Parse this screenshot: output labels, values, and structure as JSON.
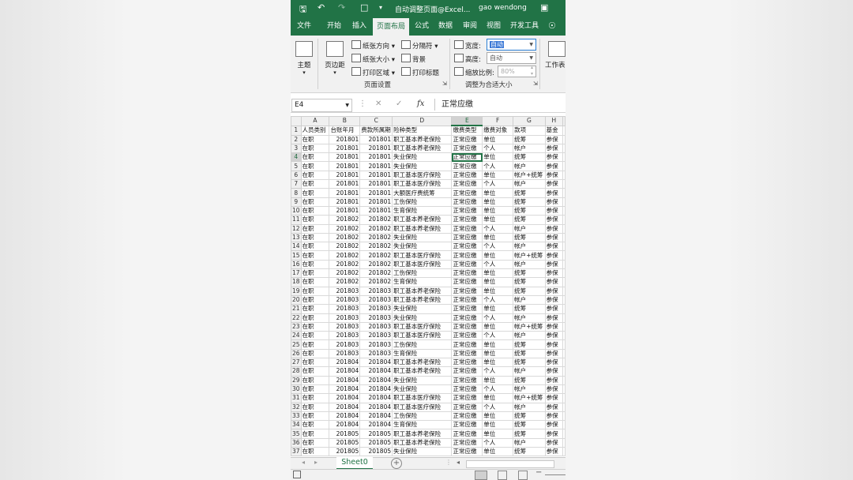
{
  "title_bar": {
    "save_icon": "save-icon",
    "undo_icon": "undo-icon",
    "redo_icon": "redo-icon",
    "new_icon": "new-file-icon",
    "title": "自动调整页面@Excel...",
    "user": "gao wendong"
  },
  "tabs": [
    "文件",
    "开始",
    "插入",
    "页面布局",
    "公式",
    "数据",
    "审阅",
    "视图",
    "开发工具"
  ],
  "active_tab": "页面布局",
  "ribbon": {
    "theme_label": "主题",
    "margins_label": "页边距",
    "orientation_label": "纸张方向",
    "size_label": "纸张大小",
    "print_area_label": "打印区域",
    "breaks_label": "分隔符",
    "background_label": "背景",
    "print_titles_label": "打印标题",
    "page_setup_group": "页面设置",
    "width_label": "宽度:",
    "width_value": "自动",
    "height_label": "高度:",
    "height_value": "自动",
    "scale_label": "缩放比例:",
    "scale_value": "80%",
    "scale_group": "调整为合适大小",
    "sheet_options_label": "工作表"
  },
  "formula_bar": {
    "name_box": "E4",
    "cancel_icon": "✕",
    "enter_icon": "✓",
    "fx_icon": "fx",
    "content": "正常应缴"
  },
  "columns": [
    "A",
    "B",
    "C",
    "D",
    "E",
    "F",
    "G",
    "H"
  ],
  "header_row": [
    "人员类别",
    "台账年月",
    "费款所属期",
    "险种类型",
    "缴费类型",
    "缴费对象",
    "款项",
    "基金"
  ],
  "rows": [
    [
      "在职",
      "201801",
      "201801",
      "职工基本养老保险",
      "正常应缴",
      "单位",
      "统筹",
      "参保"
    ],
    [
      "在职",
      "201801",
      "201801",
      "职工基本养老保险",
      "正常应缴",
      "个人",
      "帐户",
      "参保"
    ],
    [
      "在职",
      "201801",
      "201801",
      "失业保险",
      "正常应缴",
      "单位",
      "统筹",
      "参保"
    ],
    [
      "在职",
      "201801",
      "201801",
      "失业保险",
      "正常应缴",
      "个人",
      "帐户",
      "参保"
    ],
    [
      "在职",
      "201801",
      "201801",
      "职工基本医疗保险",
      "正常应缴",
      "单位",
      "帐户+统筹",
      "参保"
    ],
    [
      "在职",
      "201801",
      "201801",
      "职工基本医疗保险",
      "正常应缴",
      "个人",
      "帐户",
      "参保"
    ],
    [
      "在职",
      "201801",
      "201801",
      "大额医疗费统筹",
      "正常应缴",
      "单位",
      "统筹",
      "参保"
    ],
    [
      "在职",
      "201801",
      "201801",
      "工伤保险",
      "正常应缴",
      "单位",
      "统筹",
      "参保"
    ],
    [
      "在职",
      "201801",
      "201801",
      "生育保险",
      "正常应缴",
      "单位",
      "统筹",
      "参保"
    ],
    [
      "在职",
      "201802",
      "201802",
      "职工基本养老保险",
      "正常应缴",
      "单位",
      "统筹",
      "参保"
    ],
    [
      "在职",
      "201802",
      "201802",
      "职工基本养老保险",
      "正常应缴",
      "个人",
      "帐户",
      "参保"
    ],
    [
      "在职",
      "201802",
      "201802",
      "失业保险",
      "正常应缴",
      "单位",
      "统筹",
      "参保"
    ],
    [
      "在职",
      "201802",
      "201802",
      "失业保险",
      "正常应缴",
      "个人",
      "帐户",
      "参保"
    ],
    [
      "在职",
      "201802",
      "201802",
      "职工基本医疗保险",
      "正常应缴",
      "单位",
      "帐户+统筹",
      "参保"
    ],
    [
      "在职",
      "201802",
      "201802",
      "职工基本医疗保险",
      "正常应缴",
      "个人",
      "帐户",
      "参保"
    ],
    [
      "在职",
      "201802",
      "201802",
      "工伤保险",
      "正常应缴",
      "单位",
      "统筹",
      "参保"
    ],
    [
      "在职",
      "201802",
      "201802",
      "生育保险",
      "正常应缴",
      "单位",
      "统筹",
      "参保"
    ],
    [
      "在职",
      "201803",
      "201803",
      "职工基本养老保险",
      "正常应缴",
      "单位",
      "统筹",
      "参保"
    ],
    [
      "在职",
      "201803",
      "201803",
      "职工基本养老保险",
      "正常应缴",
      "个人",
      "帐户",
      "参保"
    ],
    [
      "在职",
      "201803",
      "201803",
      "失业保险",
      "正常应缴",
      "单位",
      "统筹",
      "参保"
    ],
    [
      "在职",
      "201803",
      "201803",
      "失业保险",
      "正常应缴",
      "个人",
      "帐户",
      "参保"
    ],
    [
      "在职",
      "201803",
      "201803",
      "职工基本医疗保险",
      "正常应缴",
      "单位",
      "帐户+统筹",
      "参保"
    ],
    [
      "在职",
      "201803",
      "201803",
      "职工基本医疗保险",
      "正常应缴",
      "个人",
      "帐户",
      "参保"
    ],
    [
      "在职",
      "201803",
      "201803",
      "工伤保险",
      "正常应缴",
      "单位",
      "统筹",
      "参保"
    ],
    [
      "在职",
      "201803",
      "201803",
      "生育保险",
      "正常应缴",
      "单位",
      "统筹",
      "参保"
    ],
    [
      "在职",
      "201804",
      "201804",
      "职工基本养老保险",
      "正常应缴",
      "单位",
      "统筹",
      "参保"
    ],
    [
      "在职",
      "201804",
      "201804",
      "职工基本养老保险",
      "正常应缴",
      "个人",
      "帐户",
      "参保"
    ],
    [
      "在职",
      "201804",
      "201804",
      "失业保险",
      "正常应缴",
      "单位",
      "统筹",
      "参保"
    ],
    [
      "在职",
      "201804",
      "201804",
      "失业保险",
      "正常应缴",
      "个人",
      "帐户",
      "参保"
    ],
    [
      "在职",
      "201804",
      "201804",
      "职工基本医疗保险",
      "正常应缴",
      "单位",
      "帐户+统筹",
      "参保"
    ],
    [
      "在职",
      "201804",
      "201804",
      "职工基本医疗保险",
      "正常应缴",
      "个人",
      "帐户",
      "参保"
    ],
    [
      "在职",
      "201804",
      "201804",
      "工伤保险",
      "正常应缴",
      "单位",
      "统筹",
      "参保"
    ],
    [
      "在职",
      "201804",
      "201804",
      "生育保险",
      "正常应缴",
      "单位",
      "统筹",
      "参保"
    ],
    [
      "在职",
      "201805",
      "201805",
      "职工基本养老保险",
      "正常应缴",
      "单位",
      "统筹",
      "参保"
    ],
    [
      "在职",
      "201805",
      "201805",
      "职工基本养老保险",
      "正常应缴",
      "个人",
      "帐户",
      "参保"
    ],
    [
      "在职",
      "201805",
      "201805",
      "失业保险",
      "正常应缴",
      "单位",
      "统筹",
      "参保"
    ]
  ],
  "selected_cell": "E4",
  "sheet_tab": "Sheet0",
  "add_sheet_icon": "+",
  "colors": {
    "accent": "#217346",
    "selection": "#d2d2d2"
  }
}
